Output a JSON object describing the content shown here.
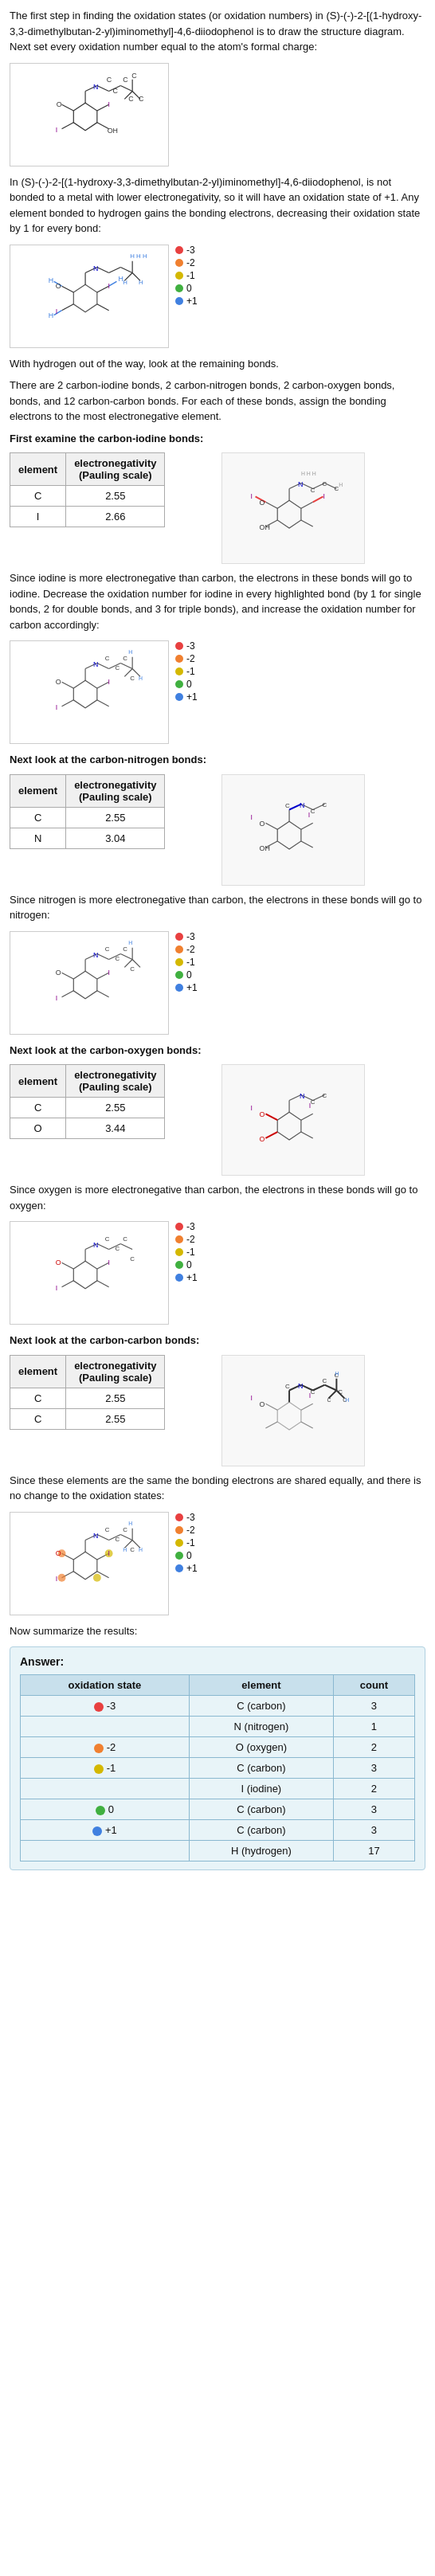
{
  "intro_text": "The first step in finding the oxidation states (or oxidation numbers) in (S)-(-)-2-[(1-hydroxy-3,3-dimethylbutan-2-yl)iminomethyl]-4,6-diiodophenol is to draw the structure diagram. Next set every oxidation number equal to the atom's formal charge:",
  "hydrogen_text": "In (S)-(-)-2-[(1-hydroxy-3,3-dimethylbutan-2-yl)iminomethyl]-4,6-diiodophenol, is not bonded to a metal with lower electronegativity, so it will have an oxidation state of +1. Any element bonded to hydrogen gains the bonding electrons, decreasing their oxidation state by 1 for every bond:",
  "remaining_bonds_text": "With hydrogen out of the way, look at the remaining bonds.",
  "bonds_description": "There are 2 carbon-iodine bonds, 2 carbon-nitrogen bonds, 2 carbon-oxygen bonds, bonds, and 12 carbon-carbon bonds. For each of these bonds, assign the bonding electrons to the most electronegative element.",
  "carbon_iodine_title": "First examine the carbon-iodine bonds:",
  "carbon_nitrogen_title": "Next look at the carbon-nitrogen bonds:",
  "carbon_oxygen_title": "Next look at the carbon-oxygen bonds:",
  "carbon_carbon_title": "Next look at the carbon-carbon bonds:",
  "same_element_text": "Since these elements are the same the bonding electrons are shared equally, and there is no change to the oxidation states:",
  "summarize_text": "Now summarize the results:",
  "answer_label": "Answer:",
  "carbon_iodine_table": {
    "headers": [
      "element",
      "electronegativity\n(Pauling scale)"
    ],
    "rows": [
      [
        "C",
        "2.55"
      ],
      [
        "I",
        "2.66"
      ]
    ]
  },
  "iodine_text": "Since iodine is more electronegative than carbon, the electrons in these bonds will go to iodine. Decrease the oxidation number for iodine in every highlighted bond (by 1 for single bonds, 2 for double bonds, and 3 for triple bonds), and increase the oxidation number for carbon accordingly:",
  "carbon_nitrogen_table": {
    "headers": [
      "element",
      "electronegativity\n(Pauling scale)"
    ],
    "rows": [
      [
        "C",
        "2.55"
      ],
      [
        "N",
        "3.04"
      ]
    ]
  },
  "nitrogen_text": "Since nitrogen is more electronegative than carbon, the electrons in these bonds will go to nitrogen:",
  "carbon_oxygen_table": {
    "headers": [
      "element",
      "electronegativity\n(Pauling scale)"
    ],
    "rows": [
      [
        "C",
        "2.55"
      ],
      [
        "O",
        "3.44"
      ]
    ]
  },
  "oxygen_text": "Since oxygen is more electronegative than carbon, the electrons in these bonds will go to oxygen:",
  "carbon_carbon_table": {
    "headers": [
      "element",
      "electronegativity\n(Pauling scale)"
    ],
    "rows": [
      [
        "C",
        "2.55"
      ],
      [
        "C",
        "2.55"
      ]
    ]
  },
  "result_table": {
    "headers": [
      "oxidation state",
      "element",
      "count"
    ],
    "rows": [
      {
        "dot_color": "#e84040",
        "state": "-3",
        "element": "C (carbon)",
        "count": "3"
      },
      {
        "dot_color": "#e84040",
        "state": "",
        "element": "N (nitrogen)",
        "count": "1"
      },
      {
        "dot_color": "#f08030",
        "state": "-2",
        "element": "O (oxygen)",
        "count": "2"
      },
      {
        "dot_color": "#d4b800",
        "state": "-1",
        "element": "C (carbon)",
        "count": "3"
      },
      {
        "dot_color": "#d4b800",
        "state": "",
        "element": "I (iodine)",
        "count": "2"
      },
      {
        "dot_color": "#40b040",
        "state": "0",
        "element": "C (carbon)",
        "count": "3"
      },
      {
        "dot_color": "#4080e0",
        "state": "+1",
        "element": "C (carbon)",
        "count": "3"
      },
      {
        "dot_color": "#4080e0",
        "state": "",
        "element": "H (hydrogen)",
        "count": "17"
      }
    ]
  },
  "dot_legend_1": [
    {
      "color": "#e84040",
      "value": "-3"
    },
    {
      "color": "#f08030",
      "value": "-2"
    },
    {
      "color": "#d4b800",
      "value": "-1"
    },
    {
      "color": "#40b040",
      "value": "0"
    },
    {
      "color": "#4080e0",
      "value": "+1"
    }
  ],
  "dot_legend_2": [
    {
      "color": "#e84040",
      "value": "-3"
    },
    {
      "color": "#f08030",
      "value": "-2"
    },
    {
      "color": "#d4b800",
      "value": "-1"
    },
    {
      "color": "#40b040",
      "value": "0"
    },
    {
      "color": "#4080e0",
      "value": "+1"
    }
  ]
}
